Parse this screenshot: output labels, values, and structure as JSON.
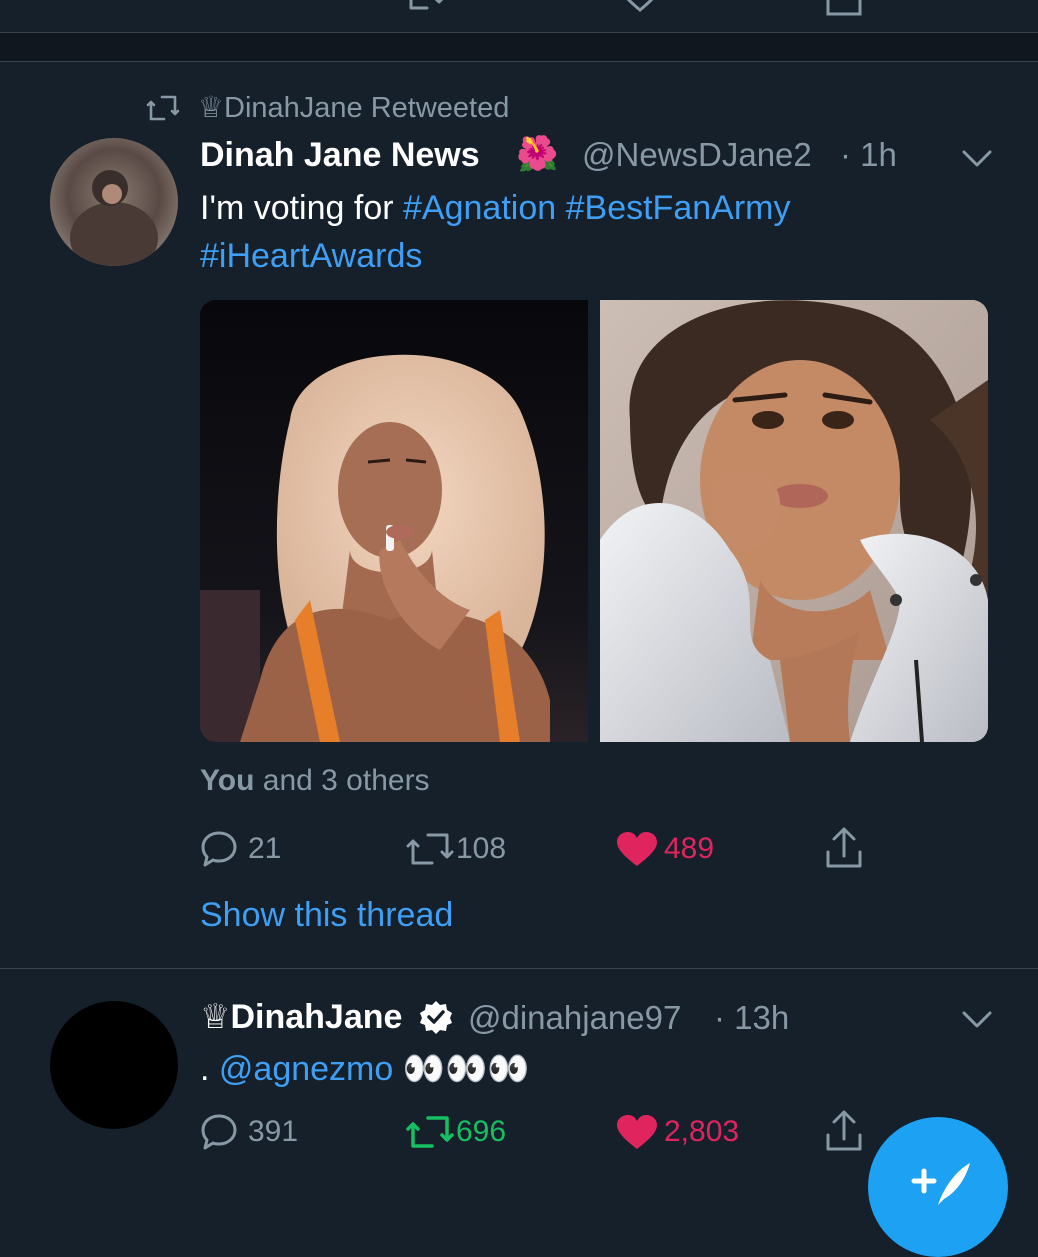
{
  "colors": {
    "background": "#15202b",
    "divider": "#38444d",
    "secondary_text": "#8899a6",
    "link": "#3e9ff5",
    "retweet_active": "#17bf63",
    "like_active": "#e0245e",
    "fab": "#1da1f2"
  },
  "tweet1": {
    "social_context": "♕DinahJane Retweeted",
    "display_name": "Dinah Jane News",
    "name_emoji": "🌺",
    "handle": "@NewsDJane2",
    "time": "· 1h",
    "text_prefix": "I'm voting for ",
    "hashtag1": "#Agnation",
    "hashtag2": "#BestFanArmy",
    "hashtag3": "#iHeartAwards",
    "images": [
      "photo-blonde-woman",
      "photo-brunette-woman"
    ],
    "liked_by_you": "You",
    "liked_by_rest": " and 3 others",
    "replies": "21",
    "retweets": "108",
    "likes": "489",
    "liked": true,
    "retweeted": false,
    "show_thread": "Show this thread"
  },
  "tweet2": {
    "display_name": "♕DinahJane",
    "verified": true,
    "handle": "@dinahjane97",
    "time": "· 13h",
    "text_prefix": ". ",
    "mention": "@agnezmo",
    "emoji": "👀👀👀",
    "replies": "391",
    "retweets": "696",
    "likes": "2,803",
    "liked": true,
    "retweeted": true
  },
  "icons": [
    "reply-icon",
    "retweet-icon",
    "like-icon",
    "share-icon",
    "chevron-down-icon",
    "verified-badge-icon",
    "compose-tweet-icon"
  ]
}
